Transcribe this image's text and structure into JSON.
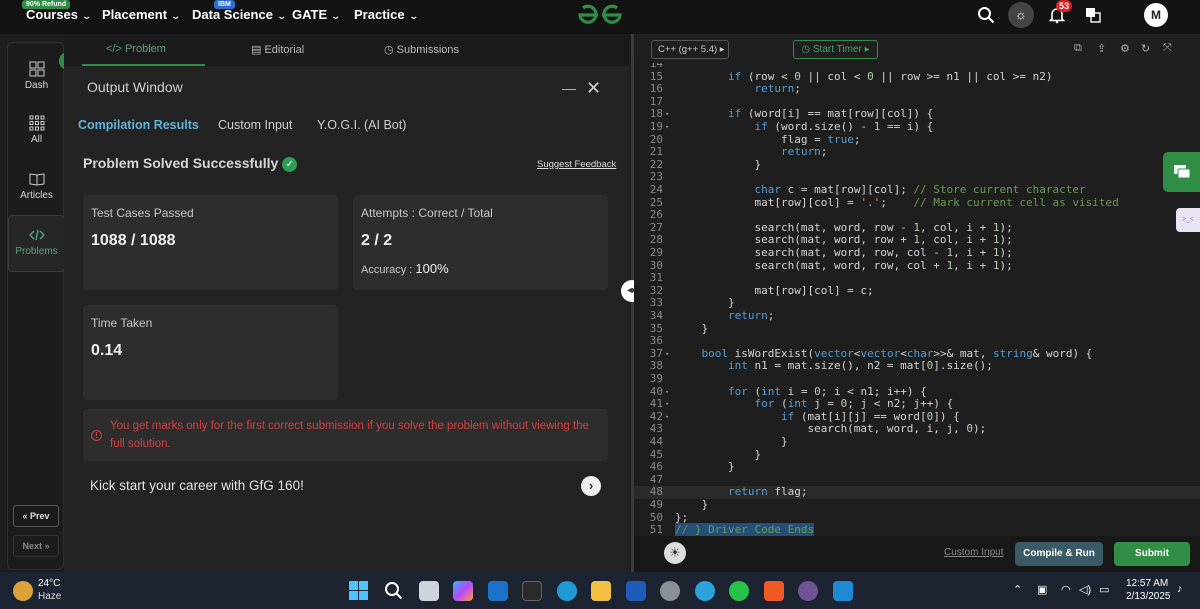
{
  "nav": {
    "items": [
      {
        "label": "Courses",
        "badge": "90% Refund"
      },
      {
        "label": "Placement",
        "badge": ""
      },
      {
        "label": "Data Science",
        "badge": "IBM"
      },
      {
        "label": "GATE",
        "badge": ""
      },
      {
        "label": "Practice",
        "badge": ""
      }
    ],
    "notification_count": "53",
    "avatar_initial": "M",
    "brand_color": "#2f8d46"
  },
  "sidebar": {
    "items": [
      {
        "label": "Dash",
        "icon": "dashboard-icon"
      },
      {
        "label": "All",
        "icon": "grid-icon"
      },
      {
        "label": "Articles",
        "icon": "book-icon"
      },
      {
        "label": "Problems",
        "icon": "code-icon"
      }
    ],
    "prev_label": "« Prev",
    "next_label": "Next »"
  },
  "left_tabs": [
    {
      "label": "Problem",
      "icon": "code-icon"
    },
    {
      "label": "Editorial",
      "icon": "document-icon"
    },
    {
      "label": "Submissions",
      "icon": "clock-icon"
    }
  ],
  "output_window": {
    "title": "Output Window",
    "tabs": [
      "Compilation Results",
      "Custom Input",
      "Y.O.G.I. (AI Bot)"
    ],
    "status": "Problem Solved Successfully",
    "suggest_feedback": "Suggest Feedback",
    "test_cases": {
      "label": "Test Cases Passed",
      "value": "1088 / 1088"
    },
    "attempts": {
      "label": "Attempts : Correct / Total",
      "value": "2 / 2",
      "accuracy_label": "Accuracy :",
      "accuracy_value": "100%"
    },
    "time_taken": {
      "label": "Time Taken",
      "value": "0.14"
    },
    "warning": "You get marks only for the first correct submission if you solve the problem without viewing the full solution.",
    "kickstart": "Kick start your career with GfG 160!"
  },
  "editor": {
    "language": "C++ (g++ 5.4)",
    "timer_label": "Start Timer",
    "custom_input": "Custom Input",
    "compile_run": "Compile & Run",
    "submit": "Submit",
    "lines": [
      {
        "n": "14",
        "fold": false,
        "code": ""
      },
      {
        "n": "15",
        "fold": false,
        "code": "        if (row < 0 || col < 0 || row >= n1 || col >= n2)"
      },
      {
        "n": "16",
        "fold": false,
        "code": "            return;"
      },
      {
        "n": "17",
        "fold": false,
        "code": ""
      },
      {
        "n": "18",
        "fold": true,
        "code": "        if (word[i] == mat[row][col]) {"
      },
      {
        "n": "19",
        "fold": true,
        "code": "            if (word.size() - 1 == i) {"
      },
      {
        "n": "20",
        "fold": false,
        "code": "                flag = true;"
      },
      {
        "n": "21",
        "fold": false,
        "code": "                return;"
      },
      {
        "n": "22",
        "fold": false,
        "code": "            }"
      },
      {
        "n": "23",
        "fold": false,
        "code": ""
      },
      {
        "n": "24",
        "fold": false,
        "code": "            char c = mat[row][col]; // Store current character"
      },
      {
        "n": "25",
        "fold": false,
        "code": "            mat[row][col] = '.';    // Mark current cell as visited"
      },
      {
        "n": "26",
        "fold": false,
        "code": ""
      },
      {
        "n": "27",
        "fold": false,
        "code": "            search(mat, word, row - 1, col, i + 1);"
      },
      {
        "n": "28",
        "fold": false,
        "code": "            search(mat, word, row + 1, col, i + 1);"
      },
      {
        "n": "29",
        "fold": false,
        "code": "            search(mat, word, row, col - 1, i + 1);"
      },
      {
        "n": "30",
        "fold": false,
        "code": "            search(mat, word, row, col + 1, i + 1);"
      },
      {
        "n": "31",
        "fold": false,
        "code": ""
      },
      {
        "n": "32",
        "fold": false,
        "code": "            mat[row][col] = c;"
      },
      {
        "n": "33",
        "fold": false,
        "code": "        }"
      },
      {
        "n": "34",
        "fold": false,
        "code": "        return;"
      },
      {
        "n": "35",
        "fold": false,
        "code": "    }"
      },
      {
        "n": "36",
        "fold": false,
        "code": ""
      },
      {
        "n": "37",
        "fold": true,
        "code": "    bool isWordExist(vector<vector<char>>& mat, string& word) {"
      },
      {
        "n": "38",
        "fold": false,
        "code": "        int n1 = mat.size(), n2 = mat[0].size();"
      },
      {
        "n": "39",
        "fold": false,
        "code": ""
      },
      {
        "n": "40",
        "fold": true,
        "code": "        for (int i = 0; i < n1; i++) {"
      },
      {
        "n": "41",
        "fold": true,
        "code": "            for (int j = 0; j < n2; j++) {"
      },
      {
        "n": "42",
        "fold": true,
        "code": "                if (mat[i][j] == word[0]) {"
      },
      {
        "n": "43",
        "fold": false,
        "code": "                    search(mat, word, i, j, 0);"
      },
      {
        "n": "44",
        "fold": false,
        "code": "                }"
      },
      {
        "n": "45",
        "fold": false,
        "code": "            }"
      },
      {
        "n": "46",
        "fold": false,
        "code": "        }"
      },
      {
        "n": "47",
        "fold": false,
        "code": ""
      },
      {
        "n": "48",
        "fold": false,
        "code": "        return flag;"
      },
      {
        "n": "49",
        "fold": false,
        "code": "    }"
      },
      {
        "n": "50",
        "fold": false,
        "code": "};"
      },
      {
        "n": "51",
        "fold": false,
        "code": "// } Driver Code Ends"
      }
    ]
  },
  "taskbar": {
    "temperature": "24°C",
    "weather": "Haze",
    "time": "12:57 AM",
    "date": "2/13/2025"
  }
}
